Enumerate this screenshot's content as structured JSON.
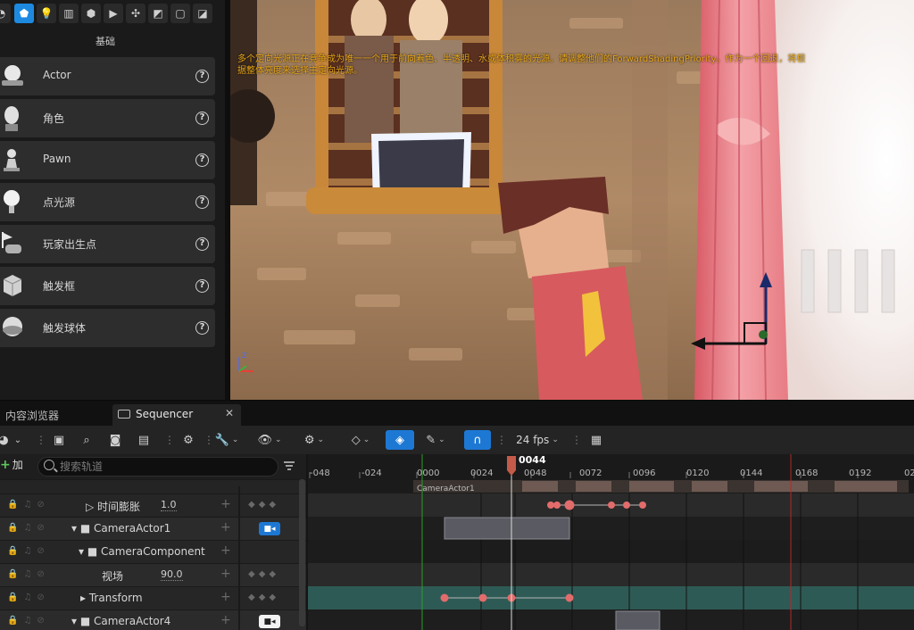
{
  "place_actors": {
    "category_title": "基础",
    "items": [
      {
        "label": "Actor",
        "icon": "sphere-on-plinth-icon"
      },
      {
        "label": "角色",
        "icon": "character-head-icon"
      },
      {
        "label": "Pawn",
        "icon": "pawn-icon"
      },
      {
        "label": "点光源",
        "icon": "light-bulb-icon"
      },
      {
        "label": "玩家出生点",
        "icon": "player-start-icon"
      },
      {
        "label": "触发框",
        "icon": "trigger-box-icon"
      },
      {
        "label": "触发球体",
        "icon": "trigger-sphere-icon"
      }
    ]
  },
  "viewport": {
    "warning_text": "多个定向光源正在竞争成为唯一一个用于前向着色、半透明、水或体积雾的光源。请调整他们的ForwardShadingPriority。作为一个回退，将根据整体亮度来选择主定向光源。"
  },
  "tabs": {
    "content_browser": "内容浏览器",
    "sequencer": "Sequencer",
    "close": "✕"
  },
  "toolbar": {
    "fps": "24 fps"
  },
  "tracklist": {
    "add_label": "加",
    "search_placeholder": "搜索轨道",
    "rows": [
      {
        "name": "时间膨胀",
        "value": "1.0"
      },
      {
        "name": "CameraActor1"
      },
      {
        "name": "CameraComponent"
      },
      {
        "name": "视场",
        "value": "90.0"
      },
      {
        "name": "Transform"
      },
      {
        "name": "CameraActor4"
      }
    ]
  },
  "timeline": {
    "playhead_frame": "0044",
    "ticks": [
      "-048",
      "-024",
      "0000",
      "0024",
      "0048",
      "0072",
      "0096",
      "0120",
      "0144",
      "0168",
      "0192",
      "02"
    ],
    "shot_label": "CameraActor1"
  },
  "colors": {
    "accent_blue": "#1d78d4",
    "keyframe": "#e26b6b",
    "transform_track": "#2e5a55",
    "warning_text": "#e8a618"
  }
}
